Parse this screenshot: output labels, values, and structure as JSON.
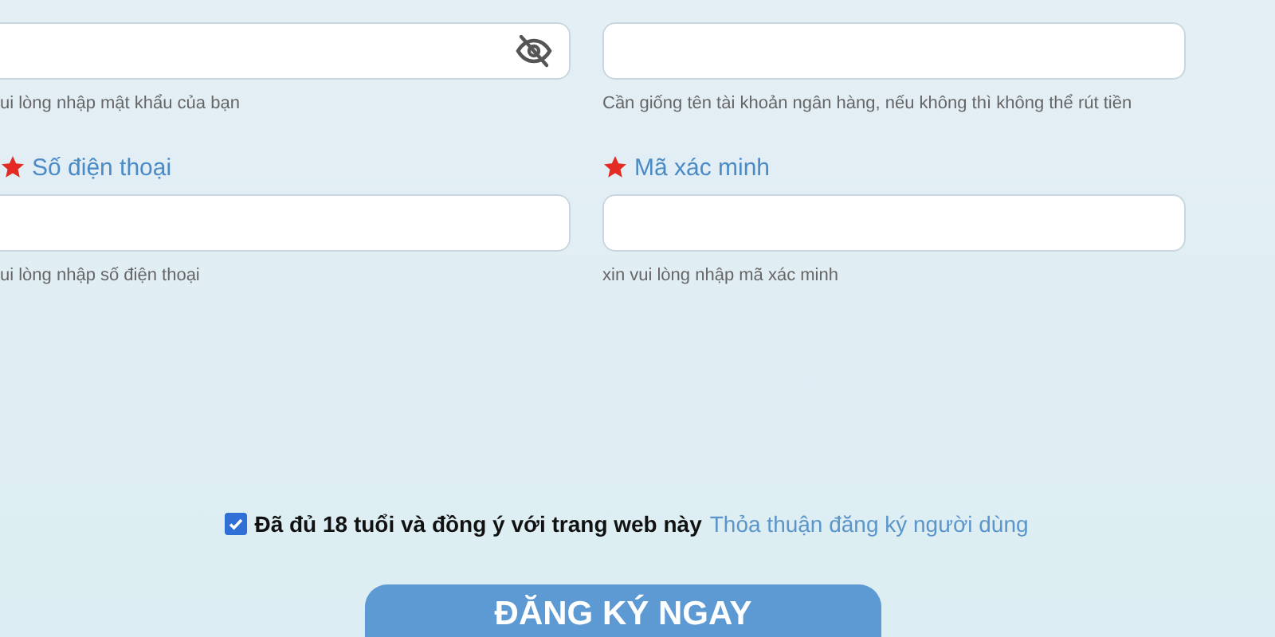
{
  "fields": [
    {
      "kind": "password",
      "hint": "ui lòng nhập mật khẩu của bạn"
    },
    {
      "kind": "text",
      "hint": "Cần giống tên tài khoản ngân hàng, nếu không thì không thể rút tiền"
    },
    {
      "kind": "text",
      "label": "Số điện thoại",
      "required": true,
      "hint": "ui lòng nhập số điện thoại"
    },
    {
      "kind": "text",
      "label": "Mã xác minh",
      "required": true,
      "hint": "xin vui lòng nhập mã xác minh"
    }
  ],
  "agreement": {
    "checked": true,
    "text": "Đã đủ 18 tuổi và đồng ý với trang web này",
    "link": "Thỏa thuận đăng ký người dùng"
  },
  "submit": "ĐĂNG KÝ NGAY"
}
